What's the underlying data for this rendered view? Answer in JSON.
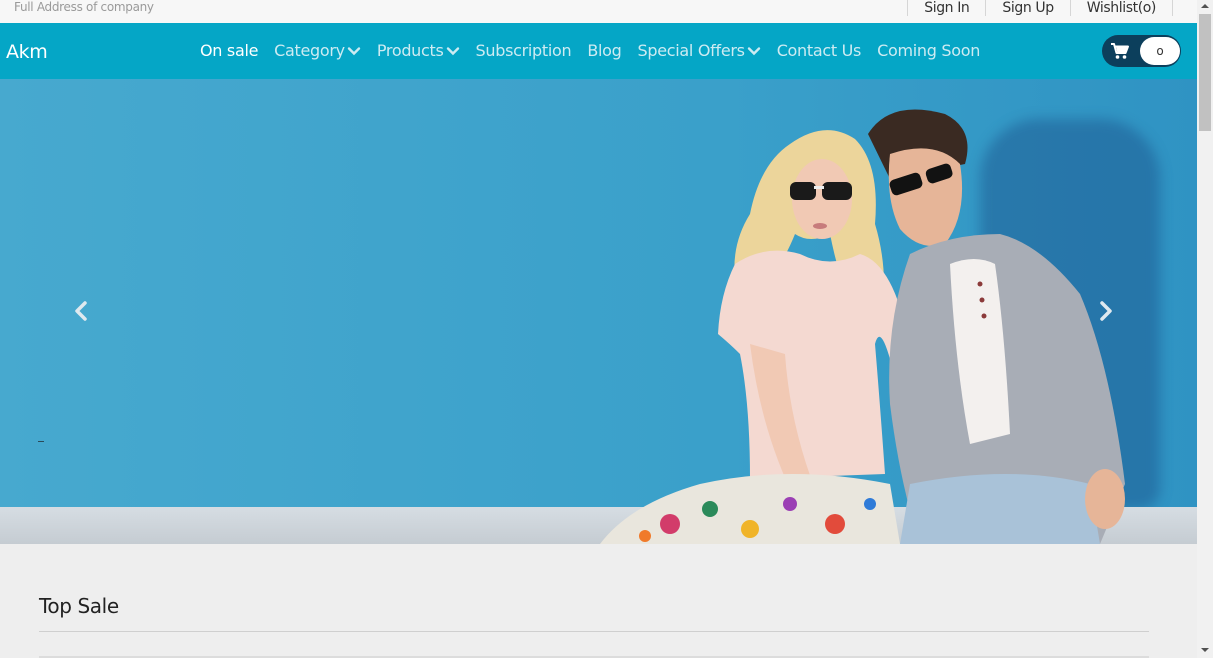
{
  "topbar": {
    "address": "Full Address of company",
    "links": [
      "Sign In",
      "Sign Up",
      "Wishlist(o)"
    ]
  },
  "navbar": {
    "brand": "Akm",
    "menu": [
      {
        "label": "On sale",
        "active": true,
        "dropdown": false
      },
      {
        "label": "Category",
        "active": false,
        "dropdown": true
      },
      {
        "label": "Products",
        "active": false,
        "dropdown": true
      },
      {
        "label": "Subscription",
        "active": false,
        "dropdown": false
      },
      {
        "label": "Blog",
        "active": false,
        "dropdown": false
      },
      {
        "label": "Special Offers",
        "active": false,
        "dropdown": true
      },
      {
        "label": "Contact Us",
        "active": false,
        "dropdown": false
      },
      {
        "label": "Coming Soon",
        "active": false,
        "dropdown": false
      }
    ],
    "cart_count": "o",
    "cart_icon": "shopping-cart-icon"
  },
  "hero": {
    "prev_icon": "chevron-left-icon",
    "next_icon": "chevron-right-icon"
  },
  "section": {
    "title": "Top Sale"
  },
  "colors": {
    "nav_bg": "#05a6c6",
    "cart_bg": "#0c3f5c",
    "hero_bg": "#44a8cd",
    "page_bg": "#eeeeee"
  }
}
